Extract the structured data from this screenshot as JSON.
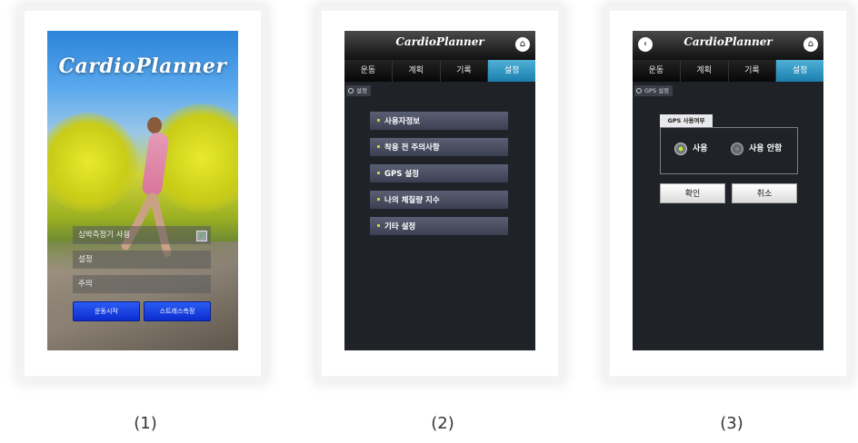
{
  "app": {
    "brand": "CardioPlanner"
  },
  "screen1": {
    "logo": "CardioPlanner",
    "options": [
      {
        "label": "심박측정기 사용",
        "checked": true
      },
      {
        "label": "설정"
      },
      {
        "label": "주의"
      }
    ],
    "buttons": {
      "start": "운동시작",
      "stress": "스트레스측정"
    }
  },
  "tabs": [
    "운동",
    "계획",
    "기록",
    "설정"
  ],
  "screen2": {
    "breadcrumb": "설정",
    "menu": [
      "사용자정보",
      "착용 전 주의사항",
      "GPS 설정",
      "나의 체질량 지수",
      "기타 설정"
    ]
  },
  "screen3": {
    "breadcrumb": "GPS 설정",
    "group_title": "GPS 사용여부",
    "option_on": "사용",
    "option_off": "사용 안함",
    "confirm": "확인",
    "cancel": "취소"
  },
  "captions": [
    "(1)",
    "(2)",
    "(3)"
  ],
  "colors": {
    "active_tab": "#2a93c2",
    "start_button": "#1a3fe0",
    "screen_bg": "#1f2227"
  },
  "icons": {
    "home": "home-icon",
    "back": "back-icon",
    "check": "check-icon",
    "radio": "radio-icon"
  }
}
